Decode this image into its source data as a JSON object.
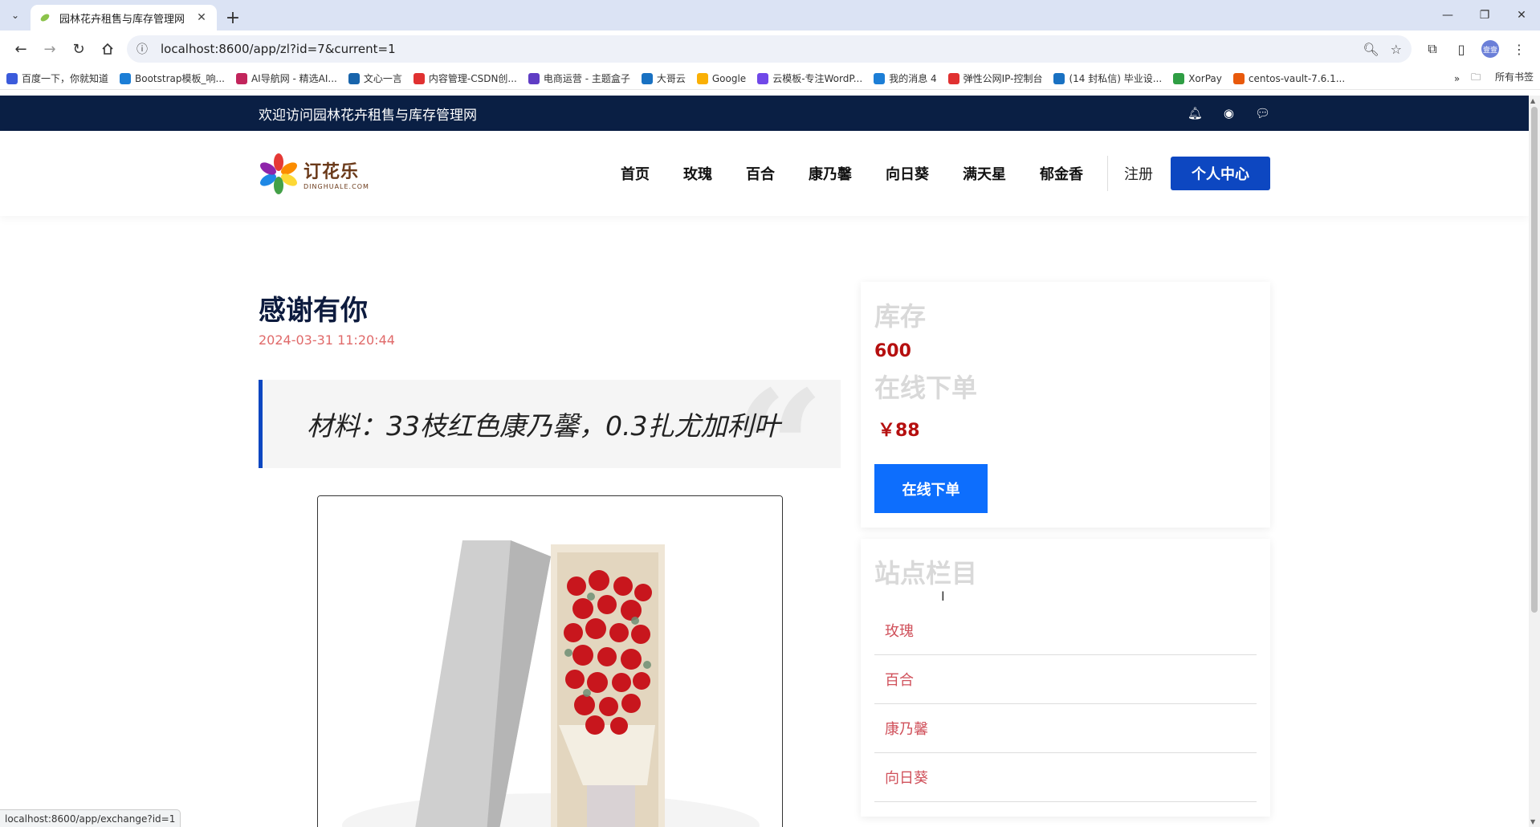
{
  "browser": {
    "tab_title": "园林花卉租售与库存管理网",
    "url": "localhost:8600/app/zl?id=7&current=1",
    "status_url": "localhost:8600/app/exchange?id=1",
    "bookmarks": [
      {
        "label": "百度一下，你就知道",
        "color": "#3b5bdb"
      },
      {
        "label": "Bootstrap模板_响...",
        "color": "#1c7ed6"
      },
      {
        "label": "AI导航网 - 精选AI...",
        "color": "#c2255c"
      },
      {
        "label": "文心一言",
        "color": "#1864ab"
      },
      {
        "label": "内容管理-CSDN创...",
        "color": "#e03131"
      },
      {
        "label": "电商运营 - 主题盒子",
        "color": "#5f3dc4"
      },
      {
        "label": "大哥云",
        "color": "#1971c2"
      },
      {
        "label": "Google",
        "color": "#fab005"
      },
      {
        "label": "云模板-专注WordP...",
        "color": "#7048e8"
      },
      {
        "label": "我的消息 4",
        "color": "#1c7ed6"
      },
      {
        "label": "弹性公网IP-控制台",
        "color": "#e03131"
      },
      {
        "label": "(14 封私信) 毕业设...",
        "color": "#1971c2"
      },
      {
        "label": "XorPay",
        "color": "#2f9e44"
      },
      {
        "label": "centos-vault-7.6.1...",
        "color": "#e8590c"
      }
    ],
    "bookmarks_folder": "所有书签",
    "avatar_text": "壹壹"
  },
  "site": {
    "welcome": "欢迎访问园林花卉租售与库存管理网",
    "logo_cn": "订花乐",
    "logo_en": "DINGHUALE.COM",
    "nav": [
      "首页",
      "玫瑰",
      "百合",
      "康乃馨",
      "向日葵",
      "满天星",
      "郁金香"
    ],
    "register": "注册",
    "user_center": "个人中心"
  },
  "post": {
    "title": "感谢有你",
    "date": "2024-03-31 11:20:44",
    "quote": "材料：33枝红色康乃馨，0.3扎尤加利叶"
  },
  "sidebar": {
    "stock_label": "库存",
    "stock_value": "600",
    "order_label": "在线下单",
    "price": "￥88",
    "order_button": "在线下单",
    "categories_title": "站点栏目",
    "categories": [
      "玫瑰",
      "百合",
      "康乃馨",
      "向日葵"
    ]
  }
}
